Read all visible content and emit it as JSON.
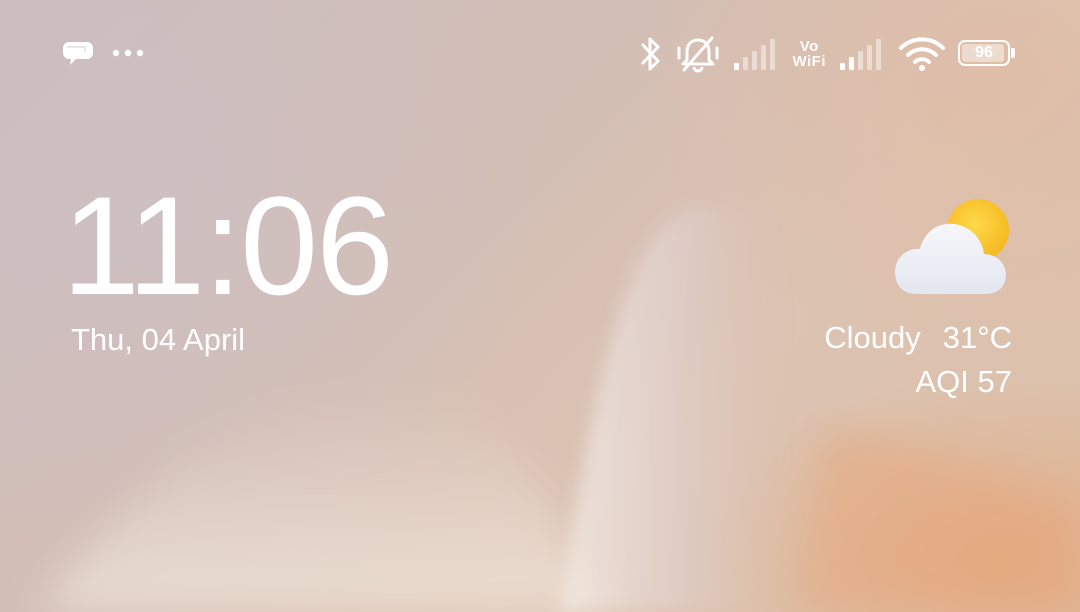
{
  "status_bar": {
    "left_icons": [
      "chat-bubble-icon",
      "more-dots-icon"
    ],
    "right_icons": [
      "bluetooth-icon",
      "ringer-muted-icon",
      "signal-1-icon",
      "vowifi-icon",
      "signal-2-icon",
      "wifi-icon",
      "battery-icon"
    ],
    "vowifi_top": "Vo",
    "vowifi_bottom": "WiFi",
    "battery_percent": "96",
    "battery_level": 0.96
  },
  "lock_screen": {
    "time": "11:06",
    "date": "Thu, 04 April"
  },
  "weather": {
    "icon": "partly-cloudy-icon",
    "condition": "Cloudy",
    "temperature": "31°C",
    "aqi": "AQI 57"
  }
}
